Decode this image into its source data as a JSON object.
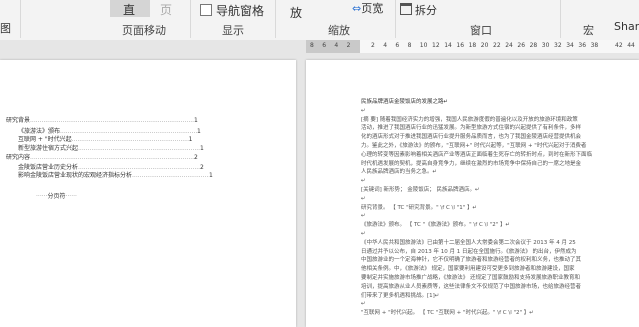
{
  "ribbon": {
    "left_fragment": "图",
    "zhi_btn": "直",
    "ye_btn": "页",
    "nav_pane": "导航窗格",
    "fang": "放",
    "page_width": "页宽",
    "split": "拆分",
    "macro": "宏",
    "share": "Share",
    "groups": {
      "page_move": "页面移动",
      "show": "显示",
      "zoom": "缩放",
      "window": "窗口",
      "macro": "宏"
    }
  },
  "ruler": {
    "ticks": [
      "8",
      "6",
      "4",
      "2",
      "",
      "2",
      "4",
      "6",
      "8",
      "10",
      "12",
      "14",
      "16",
      "18",
      "20",
      "22",
      "24",
      "26",
      "28",
      "30",
      "32",
      "34",
      "36",
      "38",
      "",
      "42",
      "44"
    ]
  },
  "toc": {
    "rows": [
      {
        "text": "研究背景",
        "page": "1"
      },
      {
        "text": "《旅游法》颁布",
        "page": "1"
      },
      {
        "text": "互联网 + \"时代兴起",
        "page": "1"
      },
      {
        "text": "新型旅游住宿方式兴起",
        "page": "1"
      },
      {
        "text": "研究内容",
        "page": "2"
      },
      {
        "text": "金陵饭店营业历史分析",
        "page": "2"
      },
      {
        "text": "影响金陵饭店营业现状的宏观经济指标分析",
        "page": "1"
      }
    ],
    "section_break": "分页符"
  },
  "doc": {
    "lines": [
      "民族品牌酒店金陵饭店的发展之路↵",
      "↵",
      "[摘 要] 随着我国经济实力的增强，我国人民旅游度假的普遍化以及开放的旅游环境和政策",
      "活动，推进了我国酒店行业的迅猛发展。为新型旅游方式住宿的兴起提供了有利条件，多样",
      "化的酒店形式对于推进我国酒店行业提升服务品质而言，也为了我国金陵酒店经营提供机会",
      "力。鉴此之外，《旅游法》的颁布，\"互联网+\" 时代兴起等，\"互联网 + \"时代兴起对于消费者",
      "心理的转变等因素影响着相关酒店产业等酒店正面临着生死存亡的转折时点，到时在新形下面临",
      "时代机遇发展的契机，提高自身竞争力，继续在激烈的市场竞争中保持自己的一席之地是金",
      "人民族品牌酒店的当务之急。↵",
      "↵",
      "[关键词] 新形势；  金陵饭店；  民族品牌酒店。↵",
      "↵",
      "研究背景。 【 TC \"研究背景。\" \\f C \\l \"1\" 】↵",
      "↵",
      "《旅游法》颁布。 【 TC \"《旅游法》颁布。\" \\f C \\l \"2\" 】↵",
      "↵",
      "《中华人民共和国旅游法》已由第十二届全国人大常委会第二次会议于 2013 年 4 月 25",
      "日通过并予以公布，自 2013 年 10 月 1 日起在全国施行。《旅游法》 的出台，伊然成为",
      "中国旅游业的一个定海神针，它不仅明确了旅游者和旅游经营者的权利和义务，也推动了其",
      "他相关条例。中，《旅游法》 规定，国家要利用建设可受更多到旅游者和旅游建设，国家",
      "要制定并实施旅游市场推广战略，《旅游法》 还规定了国家鼓励和支持发展旅游职业教育和",
      "培训，提高旅游从业人员素质等，这些法律条文不仅规范了中国旅游市场，也给旅游经营者",
      "们带来了更多机遇和挑战。[1]↵",
      "↵",
      "\"互联网 + \"时代兴起。 【 TC \"互联网 + \"时代兴起。\" \\f C \\l \"2\" 】↵"
    ]
  }
}
